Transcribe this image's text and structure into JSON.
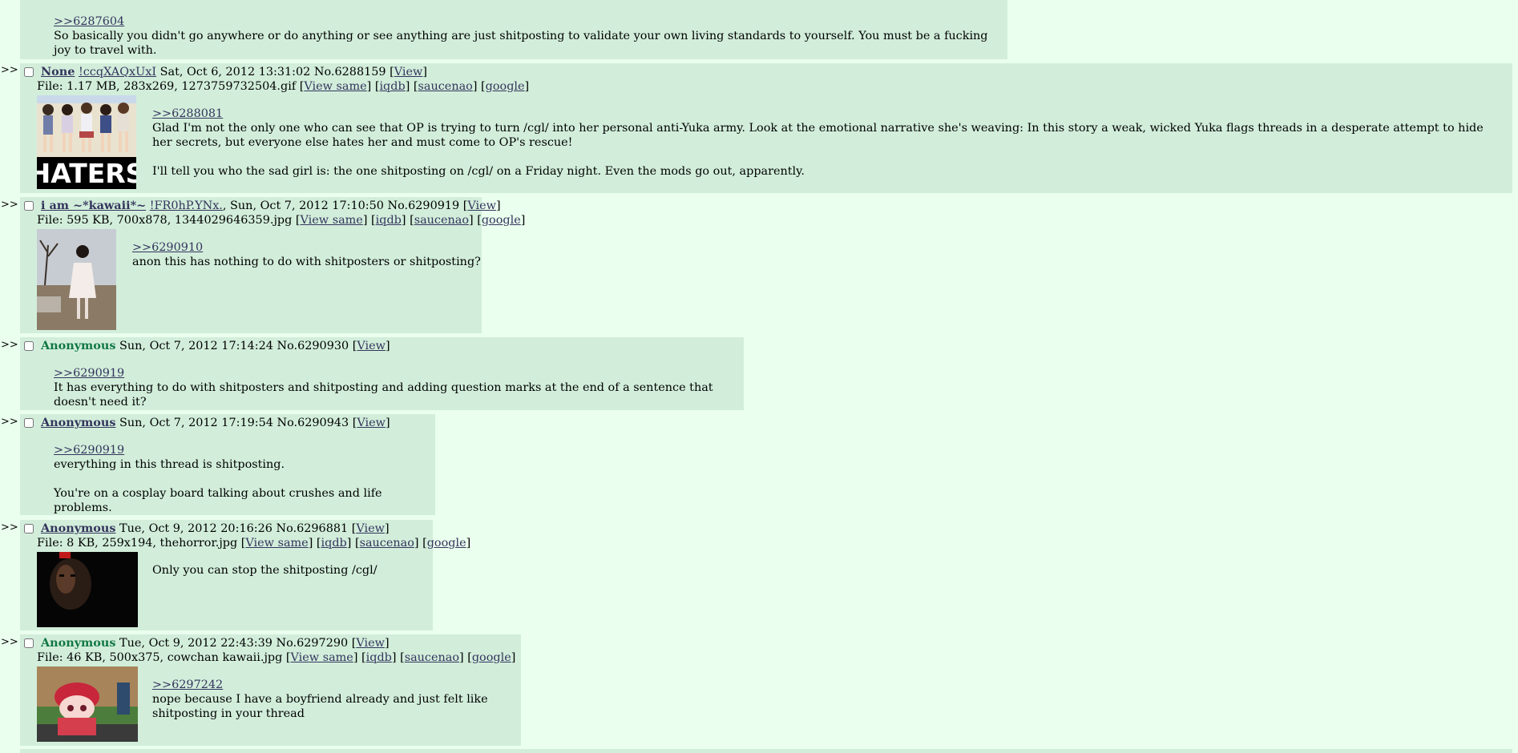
{
  "arrow": ">>",
  "top_fragment": {
    "quote": ">>6287604",
    "text": "So basically you didn't go anywhere or do anything or see anything are just shitposting to validate your own living standards to yourself. You must be a fucking joy to travel with."
  },
  "labels": {
    "view": "View",
    "view_same": "View same",
    "iqdb": "iqdb",
    "saucenao": "saucenao",
    "google": "google"
  },
  "posts": [
    {
      "name": "None",
      "tripcode": "!ccqXAQxUxI",
      "date": "Sat, Oct 6, 2012 13:31:02",
      "no": "No.6288159",
      "file": "File: 1.17 MB, 283x269, 1273759732504.gif",
      "thumb_text": "HATERS",
      "quote": ">>6288081",
      "lines": [
        "Glad I'm not the only one who can see that OP is trying to turn /cgl/ into her personal anti-Yuka army. Look at the emotional narrative she's weaving: In this story a weak, wicked Yuka flags threads in a desperate attempt to hide her secrets, but everyone else hates her and must come to OP's rescue!",
        "",
        "I'll tell you who the sad girl is: the one shitposting on /cgl/ on a Friday night. Even the mods go out, apparently."
      ]
    },
    {
      "name": "i am ~*kawaii*~",
      "tripcode": "!FR0hP.YNx.",
      "date": "Sun, Oct 7, 2012 17:10:50",
      "no": "No.6290919",
      "file": "File: 595 KB, 700x878, 1344029646359.jpg",
      "quote": ">>6290910",
      "lines": [
        "anon this has nothing to do with shitposters or shitposting?"
      ]
    },
    {
      "name": "Anonymous",
      "date": "Sun, Oct 7, 2012 17:14:24",
      "no": "No.6290930",
      "quote": ">>6290919",
      "lines": [
        "It has everything to do with shitposters and shitposting and adding question marks at the end of a sentence that doesn't need it?"
      ]
    },
    {
      "name": "Anonymous",
      "date": "Sun, Oct 7, 2012 17:19:54",
      "no": "No.6290943",
      "quote": ">>6290919",
      "lines": [
        "everything in this thread is shitposting.",
        "",
        "You're on a cosplay board talking about crushes and life problems."
      ]
    },
    {
      "name": "Anonymous",
      "date": "Tue, Oct 9, 2012 20:16:26",
      "no": "No.6296881",
      "file": "File: 8 KB, 259x194, thehorror.jpg",
      "lines": [
        "Only you can stop the shitposting /cgl/"
      ]
    },
    {
      "name": "Anonymous",
      "date": "Tue, Oct 9, 2012 22:43:39",
      "no": "No.6297290",
      "file": "File: 46 KB, 500x375, cowchan kawaii.jpg",
      "quote": ">>6297242",
      "lines": [
        "nope because I have a boyfriend already and just felt like",
        "shitposting in your thread"
      ]
    }
  ],
  "colors": {
    "page_bg": "#eaffee",
    "post_bg": "#d2eedb",
    "name": "#117743",
    "link": "#34345c"
  }
}
